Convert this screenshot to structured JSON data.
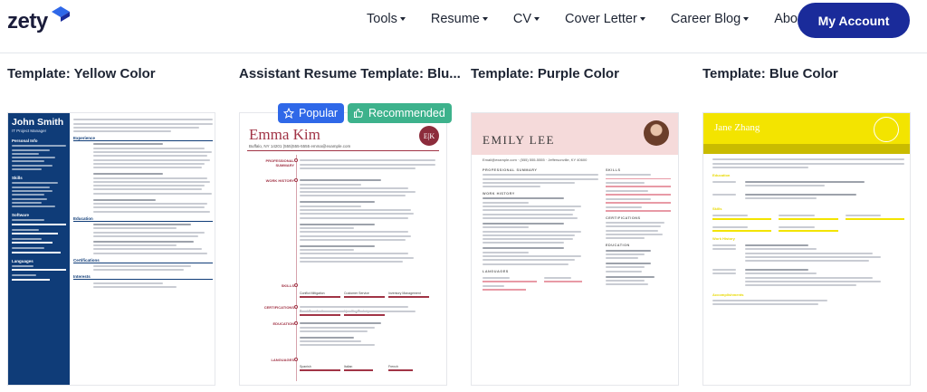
{
  "header": {
    "logo": "zety",
    "nav": [
      {
        "label": "Tools"
      },
      {
        "label": "Resume"
      },
      {
        "label": "CV"
      },
      {
        "label": "Cover Letter"
      },
      {
        "label": "Career Blog"
      },
      {
        "label": "About"
      }
    ],
    "account_button": "My Account"
  },
  "cards": [
    {
      "title": "Template: Yellow Color"
    },
    {
      "title": "Assistant Resume Template: Blu..."
    },
    {
      "title": "Template: Purple Color"
    },
    {
      "title": "Template: Blue Color"
    }
  ],
  "badges": {
    "popular": "Popular",
    "recommended": "Recommended"
  },
  "resume1": {
    "name": "John Smith",
    "role": "IT Project Manager",
    "sidebar_headings": [
      "Personal Info",
      "Skills",
      "Software",
      "Languages"
    ],
    "main_headings": [
      "Experience",
      "Education",
      "Certifications",
      "Interests"
    ]
  },
  "resume2": {
    "name": "Emma Kim",
    "monogram": "E|K",
    "contact": "Buffalo, NY 14201   (555)555-5555   emma@example.com",
    "sections": [
      "PROFESSIONAL SUMMARY",
      "WORK HISTORY",
      "SKILLS",
      "CERTIFICATIONS",
      "EDUCATION",
      "LANGUAGES"
    ]
  },
  "resume3": {
    "name": "EMILY LEE",
    "contact": "Email@example.com · (555) 555-5555 · Jeffersonville, KY 40600",
    "sections": [
      "PROFESSIONAL SUMMARY",
      "WORK HISTORY",
      "LANGUAGES"
    ],
    "right_sections": [
      "SKILLS",
      "CERTIFICATIONS",
      "EDUCATION"
    ]
  },
  "resume4": {
    "name": "Jane Zhang",
    "sections": [
      "Education",
      "Skills",
      "Work History",
      "Accomplishments"
    ]
  },
  "colors": {
    "primary": "#1a2b9a",
    "popular": "#2f68e8",
    "recommended": "#3db28c"
  }
}
